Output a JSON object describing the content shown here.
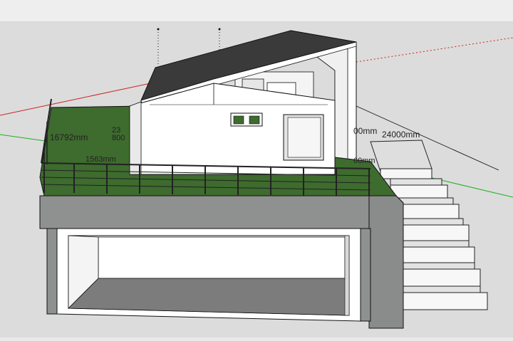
{
  "app": {
    "name": "SketchUp 3D model viewport"
  },
  "dimensions": {
    "left_width": "16792mm",
    "right_width": "24000mm",
    "right_partial": "00mm",
    "partial_1": "23",
    "partial_2": "800",
    "partial_3": "1563mm",
    "partial_4": "60mm"
  },
  "colors": {
    "background": "#dcdcdc",
    "grass": "#3e6b2e",
    "stone": "#8f9090",
    "wall": "#ffffff",
    "roof": "#3a3a3a",
    "axis_red": "#cc2222",
    "axis_green": "#1fae1f",
    "edge": "#111111"
  }
}
